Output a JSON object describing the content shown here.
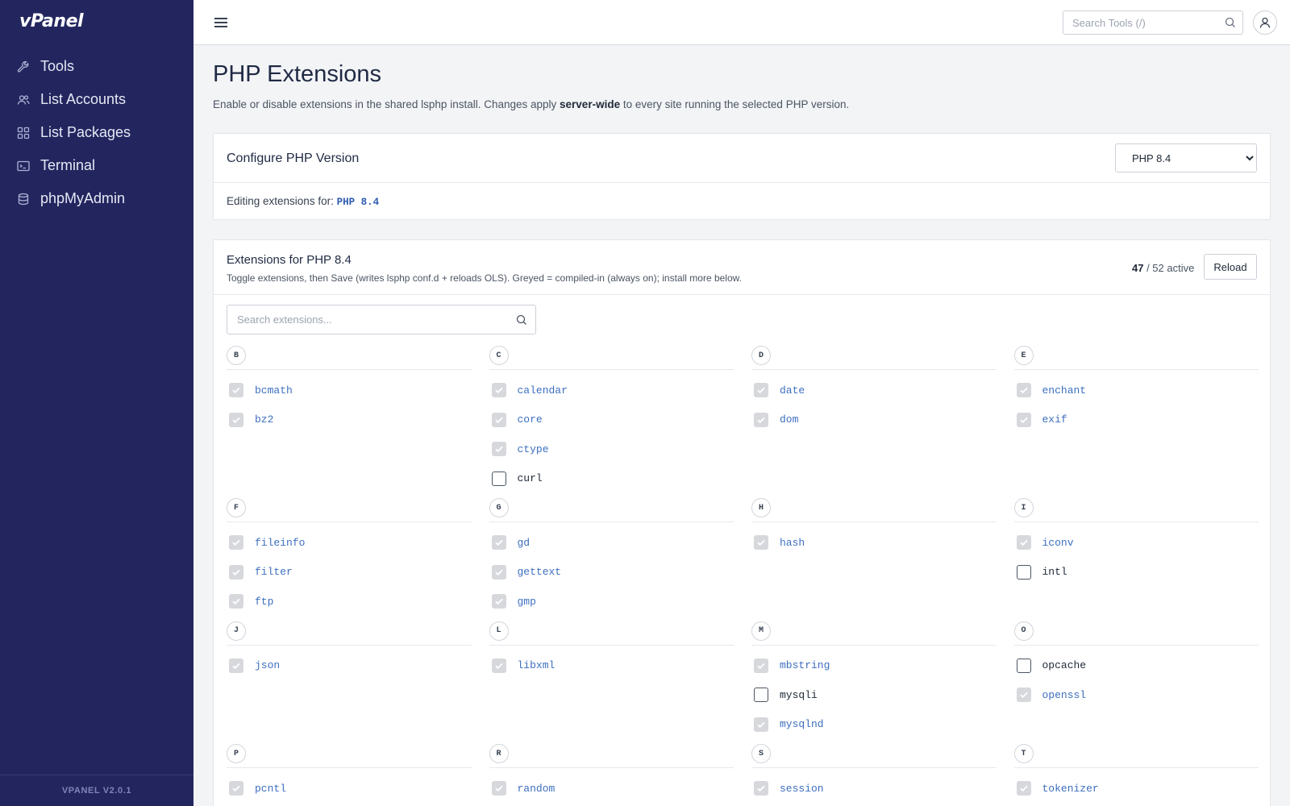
{
  "app": {
    "logo": "vPanel",
    "version": "VPANEL V2.0.1"
  },
  "sidebar": {
    "items": [
      {
        "label": "Tools",
        "icon": "wrench-icon"
      },
      {
        "label": "List Accounts",
        "icon": "users-icon"
      },
      {
        "label": "List Packages",
        "icon": "grid-icon"
      },
      {
        "label": "Terminal",
        "icon": "terminal-icon"
      },
      {
        "label": "phpMyAdmin",
        "icon": "database-icon"
      }
    ]
  },
  "topbar": {
    "search_placeholder": "Search Tools (/)"
  },
  "page": {
    "title": "PHP Extensions",
    "desc_pre": "Enable or disable extensions in the shared lsphp install. Changes apply ",
    "desc_bold": "server-wide",
    "desc_post": " to every site running the selected PHP version."
  },
  "configure": {
    "title": "Configure PHP Version",
    "selected": "PHP 8.4",
    "options": [
      "PHP 8.4"
    ],
    "editing_label": "Editing extensions for: ",
    "editing_value": "PHP 8.4"
  },
  "extensions": {
    "title": "Extensions for PHP 8.4",
    "subtitle": "Toggle extensions, then Save (writes lsphp conf.d + reloads OLS). Greyed = compiled-in (always on); install more below.",
    "active": "47",
    "total_text": " / 52 active",
    "reload_label": "Reload",
    "search_placeholder": "Search extensions...",
    "groups": [
      [
        {
          "letter": "B",
          "items": [
            {
              "name": "bcmath",
              "checked": true
            },
            {
              "name": "bz2",
              "checked": true
            }
          ]
        },
        {
          "letter": "C",
          "items": [
            {
              "name": "calendar",
              "checked": true
            },
            {
              "name": "core",
              "checked": true
            },
            {
              "name": "ctype",
              "checked": true
            },
            {
              "name": "curl",
              "checked": false
            }
          ]
        },
        {
          "letter": "D",
          "items": [
            {
              "name": "date",
              "checked": true
            },
            {
              "name": "dom",
              "checked": true
            }
          ]
        },
        {
          "letter": "E",
          "items": [
            {
              "name": "enchant",
              "checked": true
            },
            {
              "name": "exif",
              "checked": true
            }
          ]
        }
      ],
      [
        {
          "letter": "F",
          "items": [
            {
              "name": "fileinfo",
              "checked": true
            },
            {
              "name": "filter",
              "checked": true
            },
            {
              "name": "ftp",
              "checked": true
            }
          ]
        },
        {
          "letter": "G",
          "items": [
            {
              "name": "gd",
              "checked": true
            },
            {
              "name": "gettext",
              "checked": true
            },
            {
              "name": "gmp",
              "checked": true
            }
          ]
        },
        {
          "letter": "H",
          "items": [
            {
              "name": "hash",
              "checked": true
            }
          ]
        },
        {
          "letter": "I",
          "items": [
            {
              "name": "iconv",
              "checked": true
            },
            {
              "name": "intl",
              "checked": false
            }
          ]
        }
      ],
      [
        {
          "letter": "J",
          "items": [
            {
              "name": "json",
              "checked": true
            }
          ]
        },
        {
          "letter": "L",
          "items": [
            {
              "name": "libxml",
              "checked": true
            }
          ]
        },
        {
          "letter": "M",
          "items": [
            {
              "name": "mbstring",
              "checked": true
            },
            {
              "name": "mysqli",
              "checked": false
            },
            {
              "name": "mysqlnd",
              "checked": true
            }
          ]
        },
        {
          "letter": "O",
          "items": [
            {
              "name": "opcache",
              "checked": false
            },
            {
              "name": "openssl",
              "checked": true
            }
          ]
        }
      ],
      [
        {
          "letter": "P",
          "items": [
            {
              "name": "pcntl",
              "checked": true
            }
          ]
        },
        {
          "letter": "R",
          "items": [
            {
              "name": "random",
              "checked": true
            }
          ]
        },
        {
          "letter": "S",
          "items": [
            {
              "name": "session",
              "checked": true
            }
          ]
        },
        {
          "letter": "T",
          "items": [
            {
              "name": "tokenizer",
              "checked": true
            }
          ]
        }
      ]
    ]
  }
}
